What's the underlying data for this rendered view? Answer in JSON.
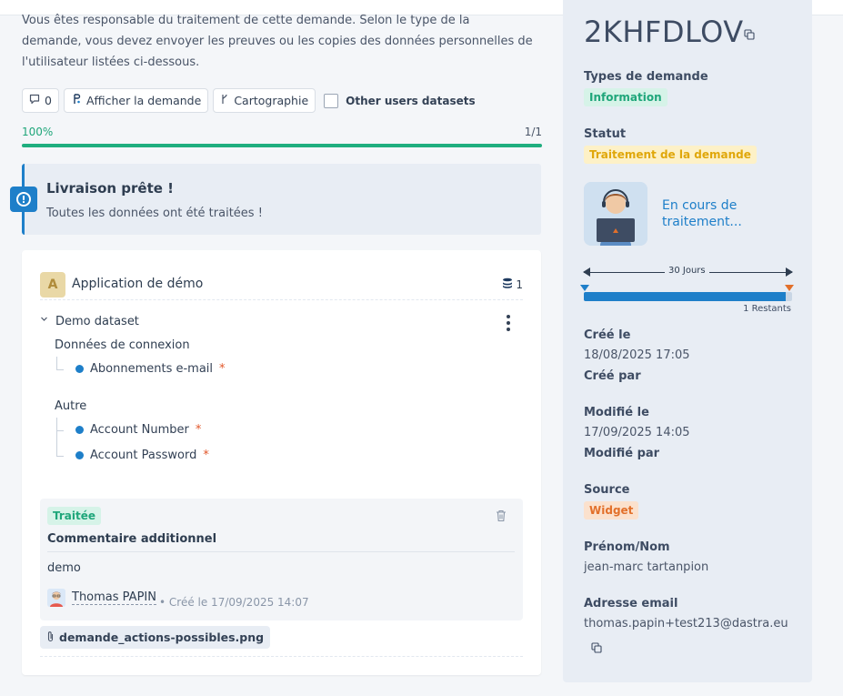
{
  "intro": {
    "line1": "Vous êtes responsable du traitement de cette demande. Selon le type de la",
    "line2": "demande, vous devez envoyer les preuves ou les copies des données personnelles de",
    "line3": "l'utilisateur listées ci-dessous."
  },
  "toolbar": {
    "comments_count": "0",
    "view_request_label": "Afficher la demande",
    "mapping_label": "Cartographie",
    "other_datasets_label": "Other users datasets"
  },
  "progress": {
    "percent_label": "100%",
    "count_label": "1/1",
    "fraction": 1.0
  },
  "alert": {
    "title": "Livraison prête !",
    "text": "Toutes les données ont été traitées !"
  },
  "application": {
    "avatar_letter": "A",
    "name": "Application de démo",
    "dataset_count": "1",
    "dataset": {
      "name": "Demo dataset",
      "groups": [
        {
          "label": "Données de connexion",
          "fields": [
            "Abonnements e-mail"
          ]
        },
        {
          "label": "Autre",
          "fields": [
            "Account Number",
            "Account Password"
          ]
        }
      ],
      "required_marker": "*"
    }
  },
  "comment": {
    "status": "Traitée",
    "title": "Commentaire additionnel",
    "body": "demo",
    "author": "Thomas PAPIN",
    "created": "• Créé le 17/09/2025 14:07"
  },
  "attachment": {
    "filename": "demande_actions-possibles.png"
  },
  "side": {
    "reference": "2KHFDLOV",
    "request_types_label": "Types de demande",
    "request_type": "Information",
    "status_label": "Statut",
    "status": "Traitement de la demande",
    "state_text_line1": "En cours de",
    "state_text_line2": "traitement...",
    "timeline": {
      "span_label": "30 Jours",
      "remaining_label": "1 Restants",
      "elapsed_fraction": 0.97
    },
    "created_label": "Créé le",
    "created_value": "18/08/2025 17:05",
    "created_by_label": "Créé par",
    "modified_label": "Modifié le",
    "modified_value": "17/09/2025 14:05",
    "modified_by_label": "Modifié par",
    "source_label": "Source",
    "source": "Widget",
    "name_label": "Prénom/Nom",
    "name_value": "jean-marc tartanpion",
    "email_label": "Adresse email",
    "email_value": "thomas.papin+test213@dastra.eu"
  },
  "colors": {
    "accent_blue": "#1e7fc9",
    "success_green": "#1fa67a",
    "warning_yellow": "#e0a70a",
    "source_orange": "#e2702b",
    "required_red": "#e2572b"
  },
  "icons": [
    "comment-icon",
    "request-icon",
    "mapping-icon",
    "database-icon",
    "chevron-down-icon",
    "kebab-icon",
    "trash-icon",
    "paperclip-icon",
    "copy-icon",
    "exclamation-icon"
  ]
}
